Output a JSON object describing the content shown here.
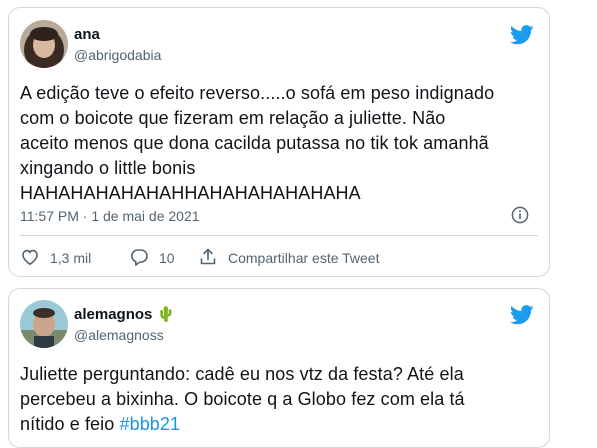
{
  "tweets": [
    {
      "display_name": "ana",
      "handle": "@abrigodabia",
      "text": "A edição teve o efeito reverso.....o sofá em peso indignado\ncom o boicote que fizeram em relação a juliette. Não\naceito menos que dona cacilda putassa no tik tok amanhã\nxingando o little bonis\nHAHAHAHAHAHAHHAHAHAHAHAHAHA",
      "timestamp": "11:57 PM · 1 de mai de 2021",
      "likes": "1,3 mil",
      "replies": "10",
      "share_label": "Compartilhar este Tweet"
    },
    {
      "display_name": "alemagnos 🌵",
      "handle": "@alemagnoss",
      "text_before": "Juliette perguntando: cadê eu nos vtz da festa? Até ela\npercebeu a bixinha. O boicote q a Globo fez com ela tá\nnítido e feio ",
      "hashtag": "#bbb21"
    }
  ],
  "colors": {
    "twitter_blue": "#1d9bf0",
    "text": "#0f1419",
    "secondary": "#536471",
    "border": "#cfd9de",
    "hashtag": "#1b95e0"
  }
}
